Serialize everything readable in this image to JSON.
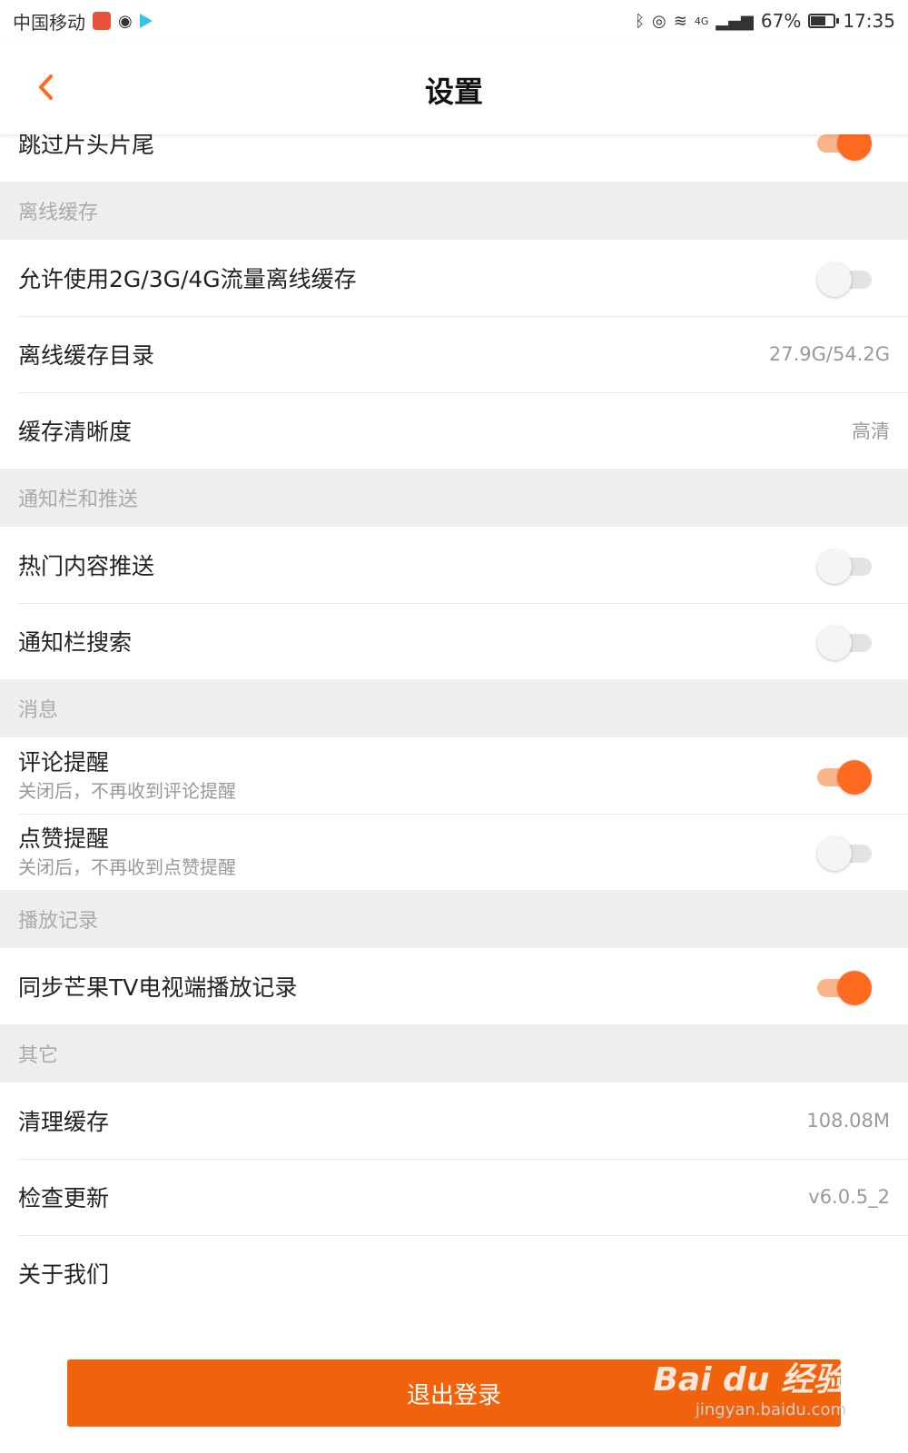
{
  "status_bar": {
    "carrier": "中国移动",
    "network": "4G",
    "battery_pct": "67%",
    "battery_level": 0.67,
    "time": "17:35"
  },
  "header": {
    "title": "设置",
    "back_icon": "chevron-left-icon",
    "accent_color": "#ff6a21"
  },
  "rows_top": {
    "skip_intro": {
      "label": "跳过片头片尾",
      "switch_on": true
    }
  },
  "sections": {
    "offline": {
      "title": "离线缓存",
      "items": [
        {
          "label": "允许使用2G/3G/4G流量离线缓存",
          "switch_on": false
        },
        {
          "label": "离线缓存目录",
          "value": "27.9G/54.2G"
        },
        {
          "label": "缓存清晰度",
          "value": "高清"
        }
      ]
    },
    "notify": {
      "title": "通知栏和推送",
      "items": [
        {
          "label": "热门内容推送",
          "switch_on": false
        },
        {
          "label": "通知栏搜索",
          "switch_on": false
        }
      ]
    },
    "messages": {
      "title": "消息",
      "items": [
        {
          "label": "评论提醒",
          "sub": "关闭后，不再收到评论提醒",
          "switch_on": true
        },
        {
          "label": "点赞提醒",
          "sub": "关闭后，不再收到点赞提醒",
          "switch_on": false
        }
      ]
    },
    "history": {
      "title": "播放记录",
      "items": [
        {
          "label": "同步芒果TV电视端播放记录",
          "switch_on": true
        }
      ]
    },
    "other": {
      "title": "其它",
      "items": [
        {
          "label": "清理缓存",
          "value": "108.08M"
        },
        {
          "label": "检查更新",
          "value": "v6.0.5_2"
        },
        {
          "label": "关于我们"
        }
      ]
    }
  },
  "logout": {
    "label": "退出登录",
    "color": "#f0620c"
  },
  "watermark": {
    "logo": "Bai du 经验",
    "url": "jingyan.baidu.com"
  }
}
